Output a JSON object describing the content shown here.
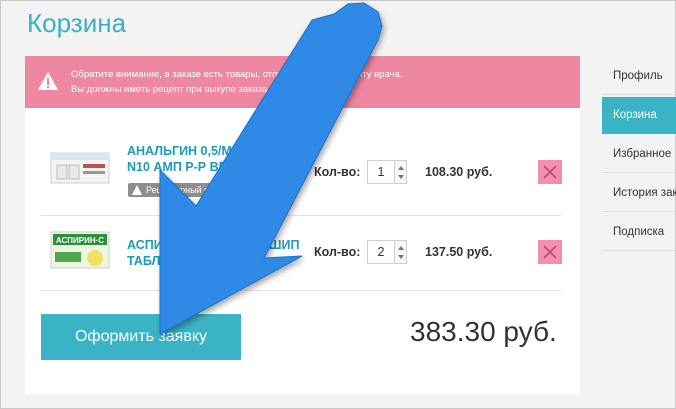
{
  "page": {
    "title": "Корзина"
  },
  "alert": {
    "line1": "Обратите внимание, в заказе есть товары, отпускаемые по рецепту врача.",
    "line2": "Вы должны иметь рецепт при выкупе заказа."
  },
  "cart": {
    "qty_label": "Кол-во:",
    "items": [
      {
        "name": "АНАЛЬГИН 0,5/МЛ 2МЛ\nN10 АМП Р-Р ВВ ВМ",
        "rx_label": "Рецептурный препарат",
        "qty": "1",
        "price": "108.30 руб."
      },
      {
        "name": "АСПИРИН-С N10 ТАБЛ ШИП\nТАБЛ",
        "qty": "2",
        "price": "137.50 руб."
      }
    ]
  },
  "checkout": {
    "button_label": "Оформить заявку",
    "total": "383.30 руб."
  },
  "sidebar": {
    "items": [
      {
        "label": "Профиль"
      },
      {
        "label": "Корзина",
        "active": true
      },
      {
        "label": "Избранное"
      },
      {
        "label": "История заказов"
      },
      {
        "label": "Подписка"
      }
    ]
  },
  "colors": {
    "accent": "#3ab4c5",
    "alert": "#ee87a2",
    "remove": "#f28fb0",
    "arrow": "#2f8ae6"
  },
  "icons": {
    "alert": "warning-icon",
    "remove": "close-icon",
    "annotation": "arrow-annotation"
  }
}
